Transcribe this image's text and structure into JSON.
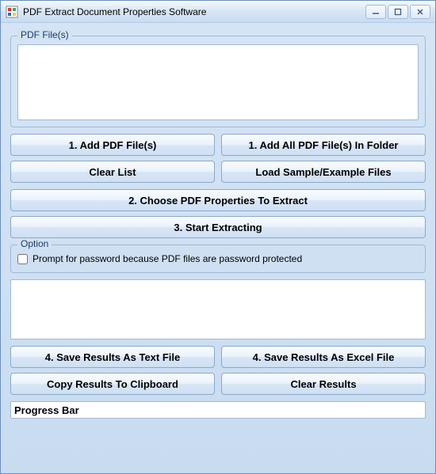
{
  "window": {
    "title": "PDF Extract Document Properties Software"
  },
  "fileGroup": {
    "legend": "PDF File(s)"
  },
  "buttons": {
    "addFiles": "1. Add PDF File(s)",
    "addAllInFolder": "1. Add All PDF File(s) In Folder",
    "clearList": "Clear List",
    "loadSample": "Load Sample/Example Files",
    "chooseProps": "2. Choose PDF Properties To Extract",
    "start": "3. Start Extracting",
    "saveText": "4. Save Results As Text File",
    "saveExcel": "4. Save Results As Excel File",
    "copyClipboard": "Copy Results To Clipboard",
    "clearResults": "Clear Results"
  },
  "optionGroup": {
    "legend": "Option",
    "promptPassword": "Prompt for password because PDF files are password protected",
    "promptPasswordChecked": false
  },
  "progress": {
    "label": "Progress Bar"
  }
}
